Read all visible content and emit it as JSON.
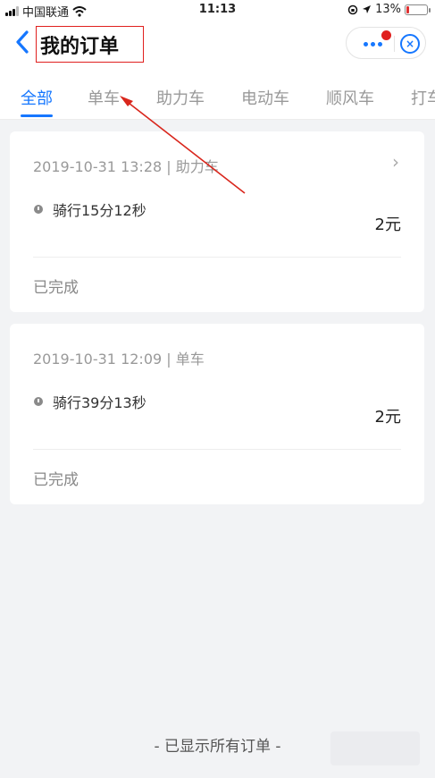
{
  "status_bar": {
    "carrier": "中国联通",
    "time": "11:13",
    "battery_percent": "13%",
    "battery_level": 0.13,
    "icons": [
      "signal-icon",
      "wifi-icon",
      "lock-rotation-icon",
      "location-icon",
      "battery-icon"
    ]
  },
  "header": {
    "back_icon": "chevron-left-icon",
    "title": "我的订单",
    "more_icon": "more-dots-icon",
    "close_icon": "close-circle-icon",
    "accent": "#1677ff",
    "highlight": "#e0201e"
  },
  "tabs": [
    {
      "label": "全部",
      "active": true
    },
    {
      "label": "单车",
      "active": false
    },
    {
      "label": "助力车",
      "active": false
    },
    {
      "label": "电动车",
      "active": false
    },
    {
      "label": "顺风车",
      "active": false
    },
    {
      "label": "打车",
      "active": false
    }
  ],
  "orders": [
    {
      "meta": "2019-10-31 13:28 | 助力车",
      "ride": "骑行15分12秒",
      "price": "2元",
      "status": "已完成"
    },
    {
      "meta": "2019-10-31 12:09 | 单车",
      "ride": "骑行39分13秒",
      "price": "2元",
      "status": "已完成"
    }
  ],
  "footer": {
    "text": "- 已显示所有订单 -"
  }
}
